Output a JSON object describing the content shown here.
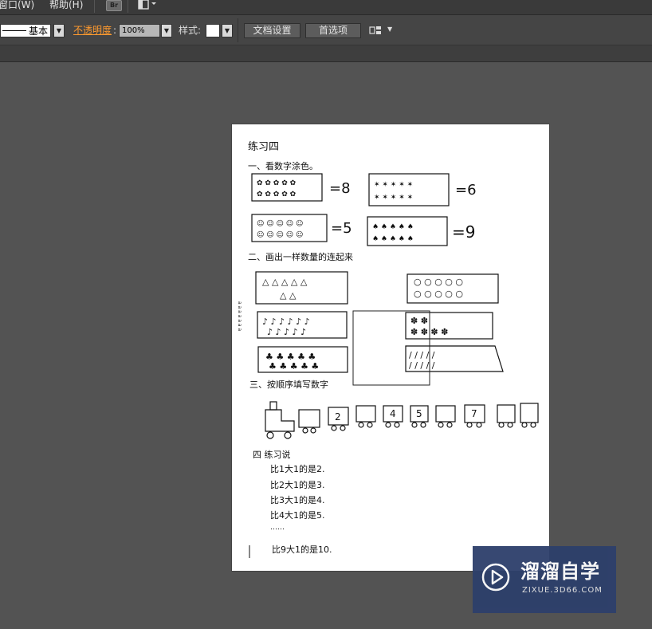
{
  "menubar": {
    "window_label": "窗口(W)",
    "help_label": "帮助(H)",
    "bridge_label": "Br",
    "workspace_icon": "workspace-switcher-icon"
  },
  "controlbar": {
    "stroke_profile": "基本",
    "opacity_label": "不透明度",
    "opacity_colon": ":",
    "opacity_value": "100%",
    "style_label": "样式:",
    "document_setup_button": "文档设置",
    "preferences_button": "首选项",
    "arrange_icon": "arrange-documents-icon"
  },
  "document": {
    "title": "练习四",
    "q1_heading": "一、看数字涂色。",
    "q1_numbers": [
      "=8",
      "=6",
      "=5",
      "=9"
    ],
    "q2_heading": "二、画出一样数量的连起来",
    "q3_heading": "三、按顺序填写数字",
    "q3_train_numbers": [
      "2",
      "4",
      "5",
      "7"
    ],
    "q4_heading": "四 练习说",
    "q4_lines": [
      "比1大1的是2.",
      "比2大1的是3.",
      "比3大1的是4.",
      "比4大1的是5.",
      "……",
      "比9大1的是10."
    ]
  },
  "watermark": {
    "brand": "溜溜自学",
    "url": "ZIXUE.3D66.COM"
  },
  "colors": {
    "workspace_bg": "#535353",
    "accent_orange": "#ff9a2e",
    "watermark_bg": "#2d3f6b"
  }
}
